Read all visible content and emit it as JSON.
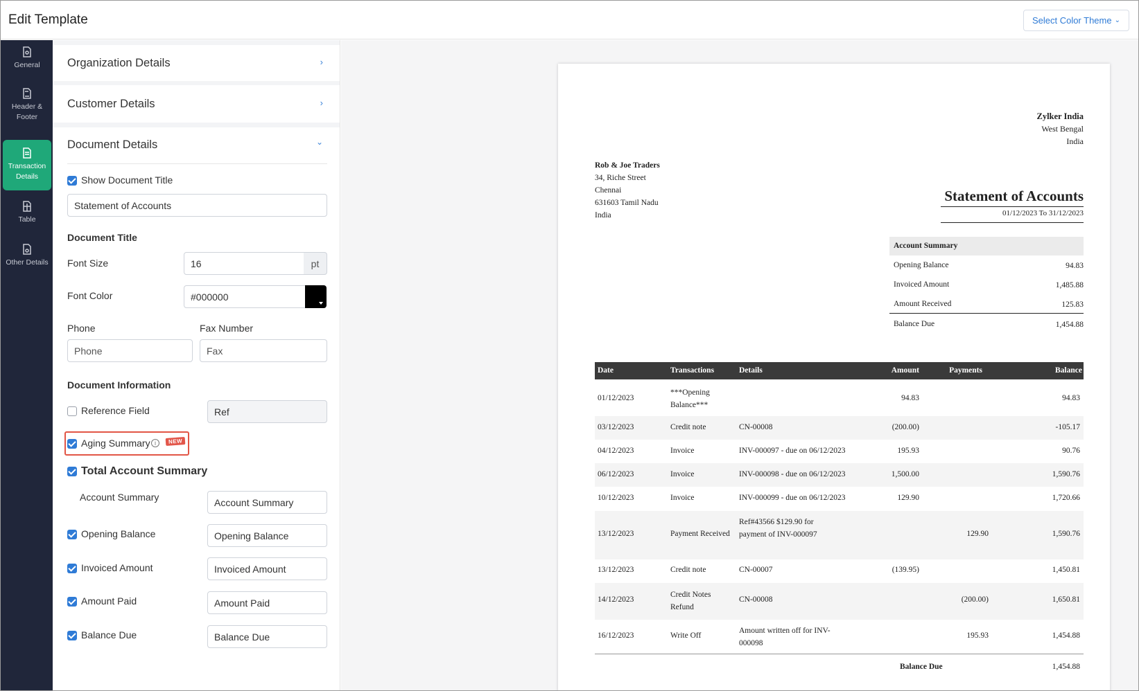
{
  "header": {
    "title": "Edit Template",
    "theme_button": "Select Color Theme"
  },
  "nav": {
    "general": "General",
    "header_footer": "Header & Footer",
    "transaction_details": "Transaction Details",
    "table": "Table",
    "other_details": "Other Details"
  },
  "panel": {
    "org_details": "Organization Details",
    "customer_details": "Customer Details",
    "document_details": "Document Details",
    "show_document_title": "Show Document Title",
    "document_title_value": "Statement of Accounts",
    "document_title_head": "Document Title",
    "font_size_label": "Font Size",
    "font_size_value": "16",
    "font_size_unit": "pt",
    "font_color_label": "Font Color",
    "font_color_value": "#000000",
    "phone_label": "Phone",
    "phone_placeholder": "Phone",
    "fax_label": "Fax Number",
    "fax_placeholder": "Fax",
    "document_info_head": "Document Information",
    "reference_field": "Reference Field",
    "reference_value": "Ref",
    "aging_summary": "Aging Summary",
    "new_badge": "NEW",
    "total_account_summary": "Total Account Summary",
    "account_summary_label": "Account Summary",
    "account_summary_value": "Account Summary",
    "opening_balance_label": "Opening Balance",
    "opening_balance_value": "Opening Balance",
    "invoiced_amount_label": "Invoiced Amount",
    "invoiced_amount_value": "Invoiced Amount",
    "amount_paid_label": "Amount Paid",
    "amount_paid_value": "Amount Paid",
    "balance_due_label": "Balance Due",
    "balance_due_value": "Balance Due",
    "checkboxes": {
      "show_document_title": true,
      "reference_field": false,
      "aging_summary": true,
      "total_account_summary": true,
      "opening_balance": true,
      "invoiced_amount": true,
      "amount_paid": true,
      "balance_due": true
    }
  },
  "colors": {
    "accent": "#2f7bd6",
    "nav_bg": "#20263a",
    "nav_active": "#1fa879",
    "highlight": "#e25545"
  },
  "statement": {
    "org": {
      "name": "Zylker India",
      "line1": "West Bengal",
      "line2": "India"
    },
    "customer": {
      "name": "Rob & Joe Traders",
      "line1": "34, Riche Street",
      "line2": "Chennai",
      "line3": "631603 Tamil Nadu",
      "line4": "India"
    },
    "title": "Statement of Accounts",
    "period": "01/12/2023 To 31/12/2023",
    "summary": {
      "head": "Account Summary",
      "opening_label": "Opening Balance",
      "opening_value": "94.83",
      "invoiced_label": "Invoiced Amount",
      "invoiced_value": "1,485.88",
      "received_label": "Amount Received",
      "received_value": "125.83",
      "due_label": "Balance Due",
      "due_value": "1,454.88"
    },
    "columns": [
      "Date",
      "Transactions",
      "Details",
      "Amount",
      "Payments",
      "Balance"
    ],
    "rows": [
      {
        "date": "01/12/2023",
        "txn": "***Opening Balance***",
        "details": "",
        "amount": "94.83",
        "payments": "",
        "balance": "94.83"
      },
      {
        "date": "03/12/2023",
        "txn": "Credit note",
        "details": "CN-00008",
        "amount": "(200.00)",
        "payments": "",
        "balance": "-105.17"
      },
      {
        "date": "04/12/2023",
        "txn": "Invoice",
        "details": "INV-000097 - due on 06/12/2023",
        "amount": "195.93",
        "payments": "",
        "balance": "90.76"
      },
      {
        "date": "06/12/2023",
        "txn": "Invoice",
        "details": "INV-000098 - due on 06/12/2023",
        "amount": "1,500.00",
        "payments": "",
        "balance": "1,590.76"
      },
      {
        "date": "10/12/2023",
        "txn": "Invoice",
        "details": "INV-000099 - due on 06/12/2023",
        "amount": "129.90",
        "payments": "",
        "balance": "1,720.66"
      },
      {
        "date": "13/12/2023",
        "txn": "Payment Received",
        "details": "Ref#43566 $129.90 for payment of INV-000097",
        "amount": "",
        "payments": "129.90",
        "balance": "1,590.76"
      },
      {
        "date": "13/12/2023",
        "txn": "Credit note",
        "details": "CN-00007",
        "amount": "(139.95)",
        "payments": "",
        "balance": "1,450.81"
      },
      {
        "date": "14/12/2023",
        "txn": "Credit Notes Refund",
        "details": "CN-00008",
        "amount": "",
        "payments": "(200.00)",
        "balance": "1,650.81"
      },
      {
        "date": "16/12/2023",
        "txn": "Write Off",
        "details": "Amount written off for INV-000098",
        "amount": "",
        "payments": "195.93",
        "balance": "1,454.88"
      }
    ],
    "footer_label": "Balance Due",
    "footer_value": "1,454.88"
  }
}
